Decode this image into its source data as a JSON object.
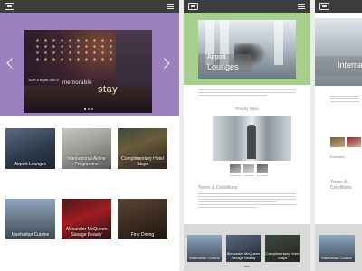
{
  "colors": {
    "topbar": "#3c3c3c",
    "hero_band": "#9b82be",
    "lounge_band": "#a6cf8e",
    "footer_band": "#d9d9d9",
    "page_bg": "#ececec"
  },
  "icons": {
    "logo": "logo-icon",
    "menu": "hamburger-menu-icon",
    "prev": "chevron-left-icon",
    "next": "chevron-right-icon"
  },
  "home": {
    "hero": {
      "caption_small": "Turn a night into a",
      "caption_mid": "memorable",
      "caption_big": "stay"
    },
    "tiles": [
      {
        "label": "Airport Lounges"
      },
      {
        "label": "International Airline Programme"
      },
      {
        "label": "Complimentary Hotel Stays"
      },
      {
        "label": "Manhattan Cuisine"
      },
      {
        "label": "Alexander McQueen Savage Beauty"
      },
      {
        "label": "Fine Dining"
      }
    ]
  },
  "lounges": {
    "hero_title_1": "Airport",
    "hero_title_2": "Lounges",
    "section_priority": "Priority Pass",
    "section_terms": "Terms & Conditions",
    "footer_tiles": [
      {
        "label": "Manhattan Cuisine"
      },
      {
        "label": "Alexander McQueen Savage Beauty"
      },
      {
        "label": "Complimentary Hotel Stays"
      }
    ]
  },
  "third": {
    "hero_title": "International",
    "thumb_caption": "Emirates",
    "section_terms": "Terms & Conditions",
    "footer_tile": "Manhattan Cuisine"
  }
}
